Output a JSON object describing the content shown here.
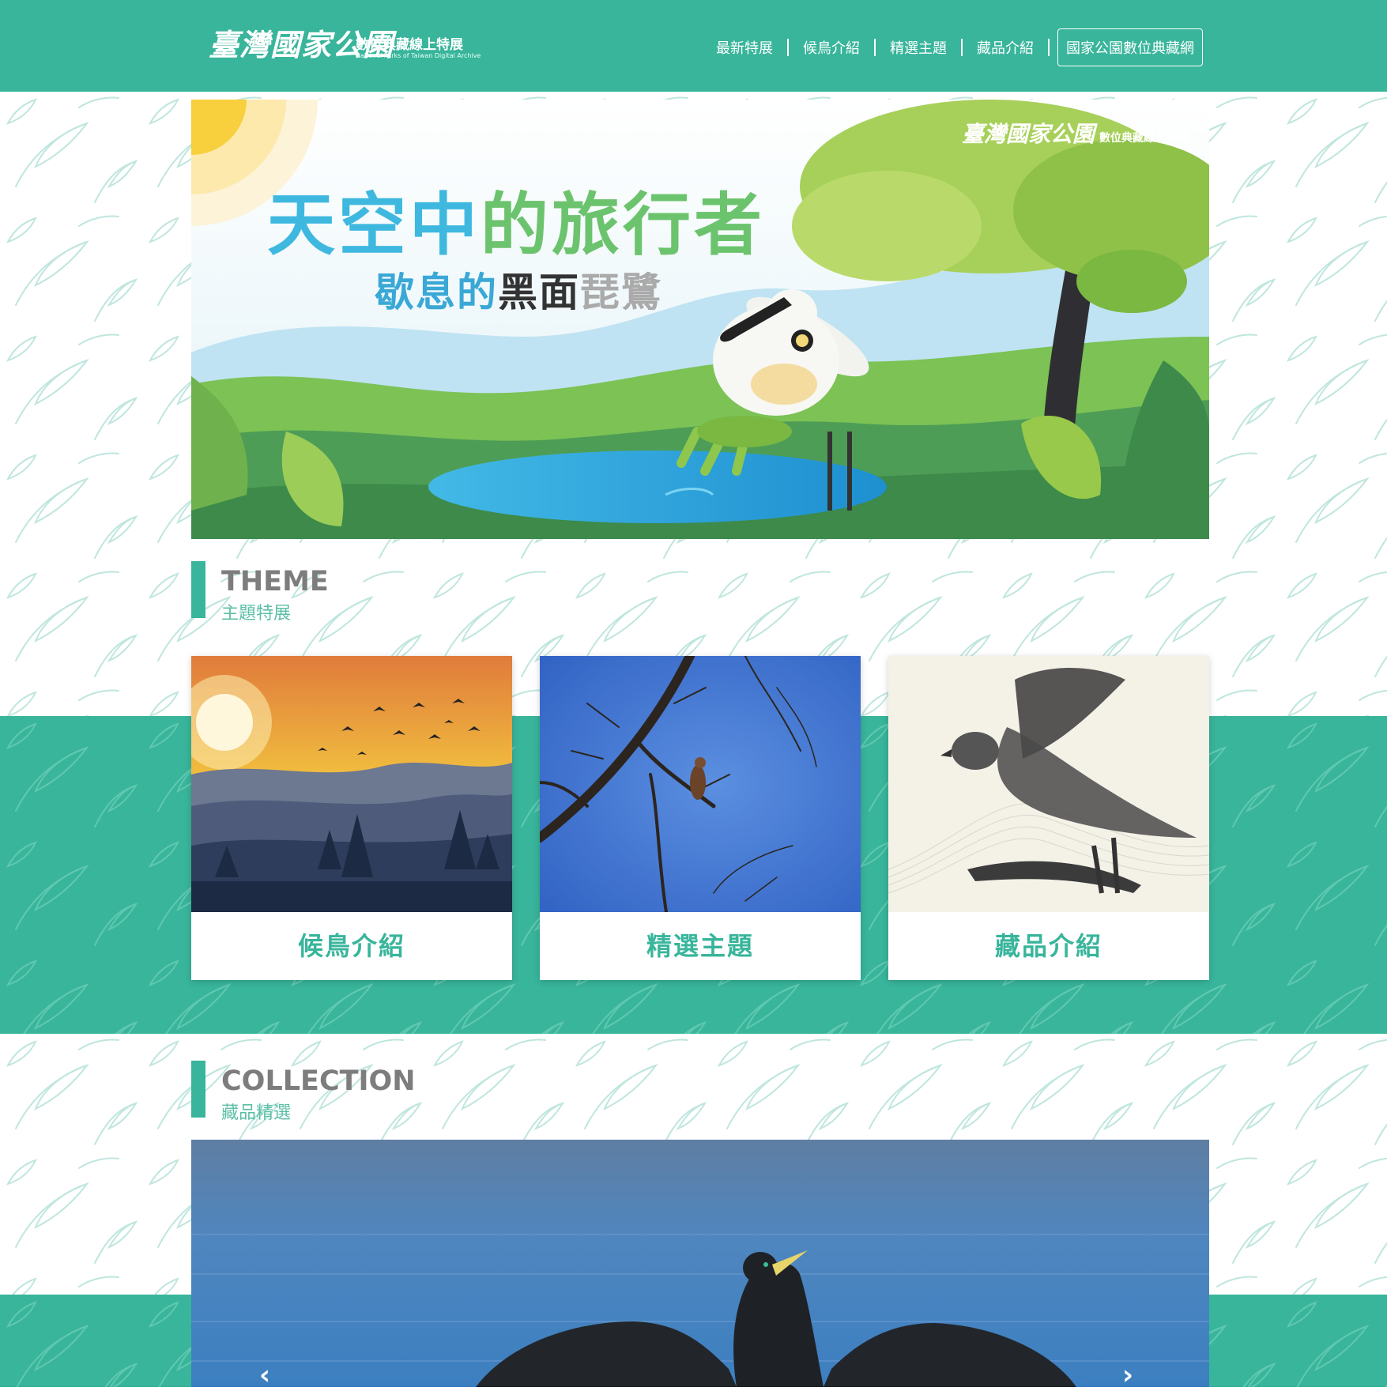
{
  "header": {
    "logo_title": "臺灣國家公園",
    "logo_subtitle": "數位典藏線上特展",
    "logo_english": "National Parks of Taiwan Digital Archive",
    "nav": [
      "最新特展",
      "候鳥介紹",
      "精選主題",
      "藏品介紹"
    ],
    "nav_button": "國家公園數位典藏網"
  },
  "banner": {
    "title_part1": "天空中",
    "title_part2": "的旅行者",
    "subtitle_part1": "歇息的",
    "subtitle_part2": "黑面",
    "subtitle_part3": "琵鷺",
    "logo_title": "臺灣國家公園",
    "logo_subtitle": "數位典藏線上特展"
  },
  "theme": {
    "heading_en": "THEME",
    "heading_zh": "主題特展",
    "cards": [
      {
        "label": "候鳥介紹",
        "image": "sunset-birds-mountains"
      },
      {
        "label": "精選主題",
        "image": "hawk-on-branch"
      },
      {
        "label": "藏品介紹",
        "image": "kestrel-sketch"
      }
    ]
  },
  "collection": {
    "heading_en": "COLLECTION",
    "heading_zh": "藏品精選",
    "image": "cormorant-spreading-wings",
    "prev_arrow": "‹",
    "next_arrow": "›"
  },
  "colors": {
    "brand_green": "#38b59b",
    "heading_gray": "#7d7d7d",
    "sky_blue": "#3fb8e0"
  }
}
